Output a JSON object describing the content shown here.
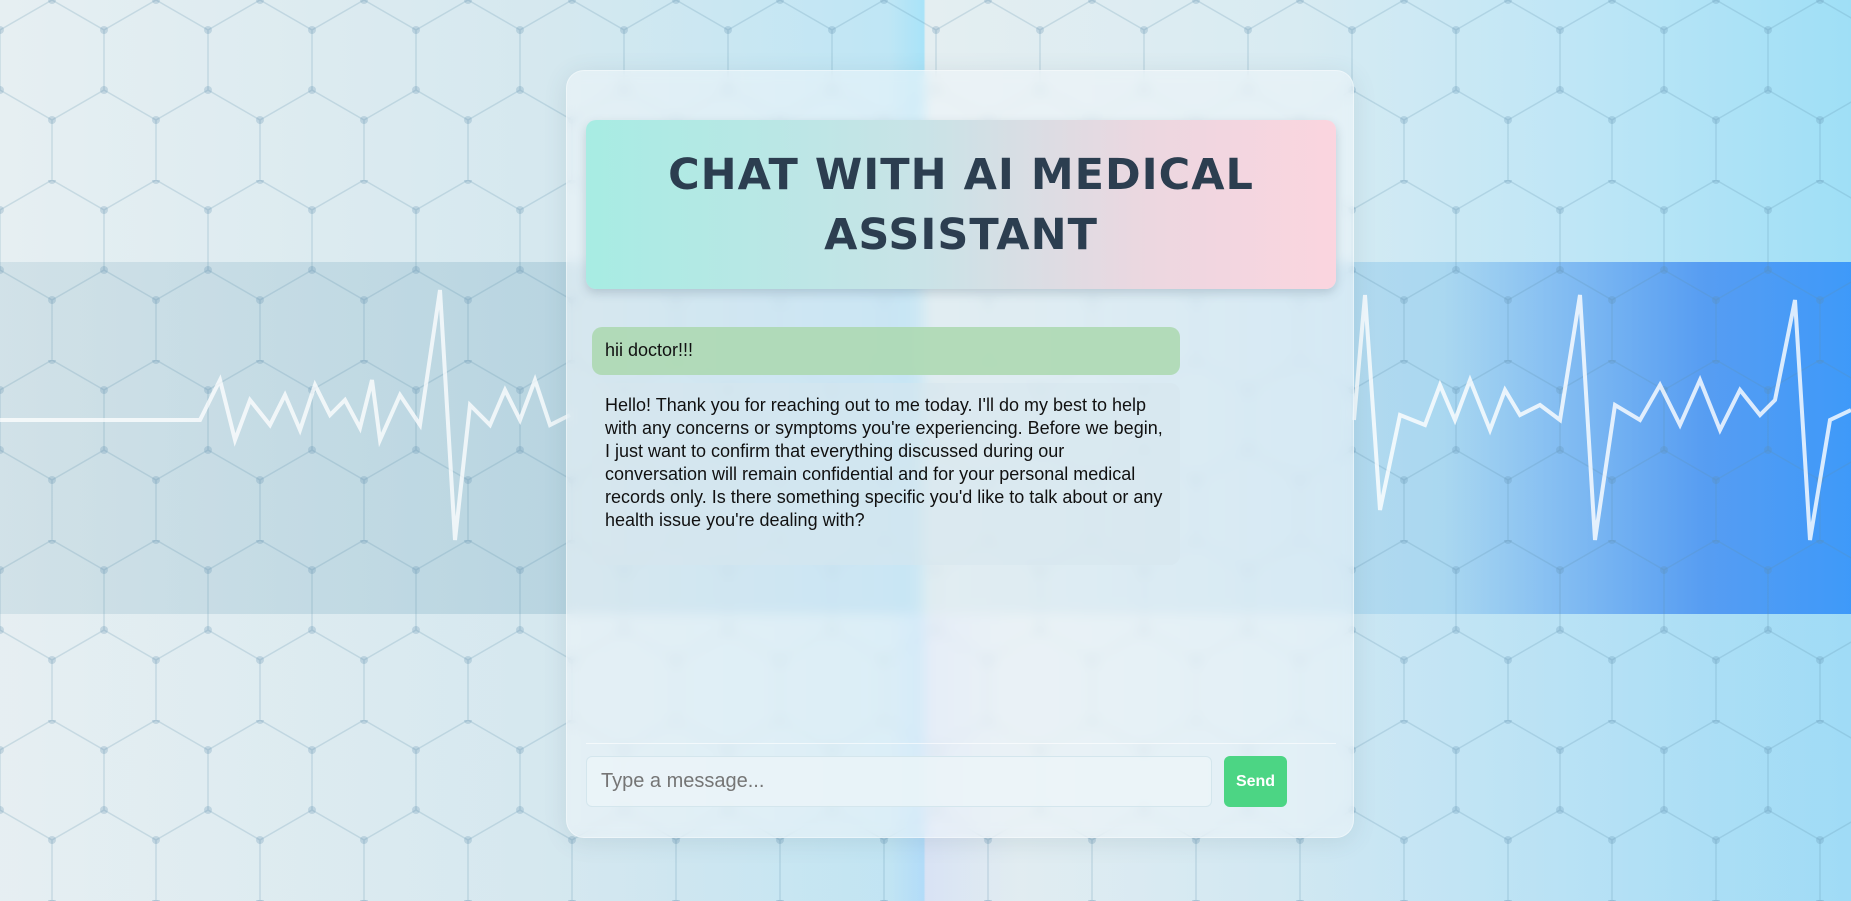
{
  "header": {
    "title": "CHAT WITH AI MEDICAL ASSISTANT"
  },
  "messages": [
    {
      "role": "user",
      "text": "hii doctor!!!"
    },
    {
      "role": "assistant",
      "text": "Hello! Thank you for reaching out to me today. I'll do my best to help with any concerns or symptoms you're experiencing. Before we begin, I just want to confirm that everything discussed during our conversation will remain confidential and for your personal medical records only. Is there something specific you'd like to talk about or any health issue you're dealing with?"
    }
  ],
  "composer": {
    "placeholder": "Type a message...",
    "value": "",
    "send_label": "Send"
  },
  "colors": {
    "title_text": "#2c3e50",
    "header_gradient_start": "#a7ece3",
    "header_gradient_end": "#fbd5df",
    "user_bubble": "#aad8af",
    "send_button": "#4cd584"
  }
}
